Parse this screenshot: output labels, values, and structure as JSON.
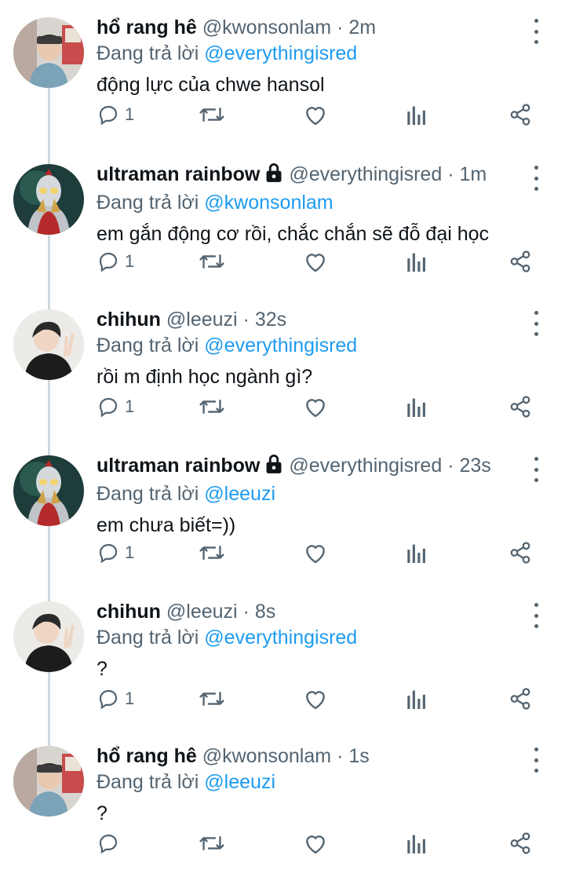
{
  "colors": {
    "accent": "#1d9bf0",
    "secondary_text": "#536471",
    "primary_text": "#0f1419",
    "thread_line": "#cfd9de"
  },
  "tweets": [
    {
      "name": "hổ rang hê",
      "locked": false,
      "handle": "@kwonsonlam",
      "dot": "·",
      "time": "2m",
      "reply_prefix": "Đang trả lời",
      "reply_to": "@everythingisred",
      "text": "động lực của chwe hansol",
      "reply_count": "1",
      "avatar_icon": "avatar-kwonsonlam-icon"
    },
    {
      "name": "ultraman rainbow",
      "locked": true,
      "handle": "@everythingisred",
      "dot": "·",
      "time": "1m",
      "reply_prefix": "Đang trả lời",
      "reply_to": "@kwonsonlam",
      "text": "em gắn động cơ rồi, chắc chắn sẽ đỗ đại học",
      "reply_count": "1",
      "avatar_icon": "avatar-ultraman-icon"
    },
    {
      "name": "chihun",
      "locked": false,
      "handle": "@leeuzi",
      "dot": "·",
      "time": "32s",
      "reply_prefix": "Đang trả lời",
      "reply_to": "@everythingisred",
      "text": "rồi m định học ngành gì?",
      "reply_count": "1",
      "avatar_icon": "avatar-leeuzi-icon"
    },
    {
      "name": "ultraman rainbow",
      "locked": true,
      "handle": "@everythingisred",
      "dot": "·",
      "time": "23s",
      "reply_prefix": "Đang trả lời",
      "reply_to": "@leeuzi",
      "text": "em chưa biết=))",
      "reply_count": "1",
      "avatar_icon": "avatar-ultraman-icon"
    },
    {
      "name": "chihun",
      "locked": false,
      "handle": "@leeuzi",
      "dot": "·",
      "time": "8s",
      "reply_prefix": "Đang trả lời",
      "reply_to": "@everythingisred",
      "text": "?",
      "reply_count": "1",
      "avatar_icon": "avatar-leeuzi-icon"
    },
    {
      "name": "hổ rang hê",
      "locked": false,
      "handle": "@kwonsonlam",
      "dot": "·",
      "time": "1s",
      "reply_prefix": "Đang trả lời",
      "reply_to": "@leeuzi",
      "text": "?",
      "reply_count": "",
      "avatar_icon": "avatar-kwonsonlam-icon"
    }
  ]
}
